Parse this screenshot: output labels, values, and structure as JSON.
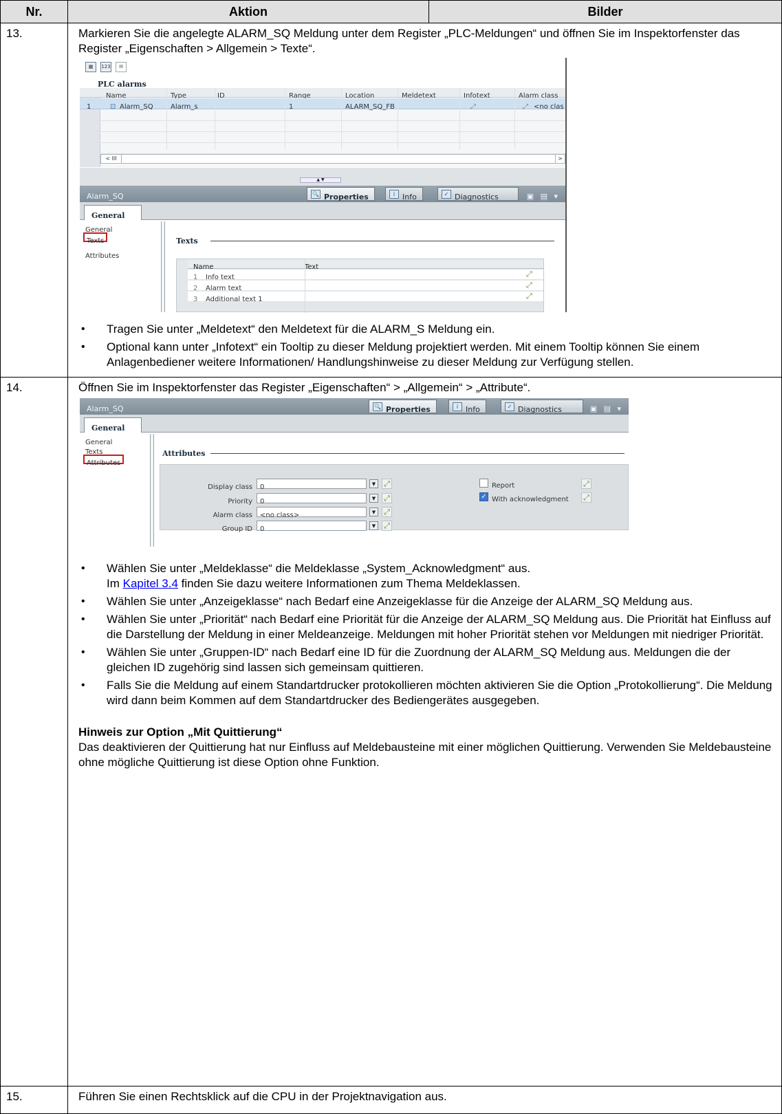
{
  "header": {
    "nr": "Nr.",
    "aktion": "Aktion",
    "bilder": "Bilder"
  },
  "step13": {
    "nr": "13.",
    "intro": "Markieren Sie die angelegte ALARM_SQ Meldung unter dem Register „PLC-Meldungen“ und öffnen Sie im Inspektorfenster das Register „Eigenschaften > Allgemein > Texte“.",
    "screenshot": {
      "panel_title": "PLC alarms",
      "columns": [
        "Name",
        "Type",
        "ID",
        "Range",
        "Location",
        "Meldetext",
        "Infotext",
        "Alarm class"
      ],
      "row": {
        "num": "1",
        "name": "Alarm_SQ",
        "type": "Alarm_s",
        "id": "",
        "range": "1",
        "location": "ALARM_SQ_FB",
        "meldetext": "",
        "infotext_icon": "link-icon",
        "alarm_class": "<no clas"
      },
      "scroll_left": "< III",
      "scroll_right": ">",
      "inspector_title": "Alarm_SQ",
      "tab_properties": "Properties",
      "tab_info": "Info",
      "tab_diagnostics": "Diagnostics",
      "general_tab": "General",
      "nav": [
        "General",
        "Texts",
        "Attributes"
      ],
      "section": "Texts",
      "text_columns": [
        "Name",
        "Text"
      ],
      "text_rows": [
        {
          "num": "1",
          "name": "Info text"
        },
        {
          "num": "2",
          "name": "Alarm text"
        },
        {
          "num": "3",
          "name": "Additional text 1"
        }
      ]
    },
    "bullets": [
      "Tragen Sie unter „Meldetext“ den Meldetext für die ALARM_S Meldung ein.",
      "Optional kann unter „Infotext“ ein Tooltip zu dieser Meldung projektiert werden. Mit einem Tooltip können Sie einem Anlagenbediener weitere Informationen/ Handlungshinweise zu dieser Meldung zur Verfügung stellen."
    ]
  },
  "step14": {
    "nr": "14.",
    "intro": "Öffnen Sie im Inspektorfenster das Register „Eigenschaften“ > „Allgemein“ > „Attribute“.",
    "screenshot": {
      "inspector_title": "Alarm_SQ",
      "tab_properties": "Properties",
      "tab_info": "Info",
      "tab_diagnostics": "Diagnostics",
      "general_tab": "General",
      "nav": [
        "General",
        "Texts",
        "Attributes"
      ],
      "section": "Attributes",
      "fields": [
        {
          "label": "Display class",
          "value": "0"
        },
        {
          "label": "Priority",
          "value": "0"
        },
        {
          "label": "Alarm class",
          "value": "<no class>"
        },
        {
          "label": "Group ID",
          "value": "0"
        }
      ],
      "checkboxes": [
        {
          "label": "Report",
          "checked": false
        },
        {
          "label": "With acknowledgment",
          "checked": true
        }
      ]
    },
    "bullet1_a": "Wählen Sie unter „Meldeklasse“ die Meldeklasse „System_Acknowledgment“ aus.",
    "bullet1_b_pre": "Im ",
    "bullet1_link": "Kapitel 3.4",
    "bullet1_b_post": " finden Sie dazu weitere Informationen zum Thema Meldeklassen.",
    "bullets": [
      "Wählen Sie unter „Anzeigeklasse“ nach Bedarf eine Anzeigeklasse für die Anzeige der ALARM_SQ Meldung aus.",
      "Wählen Sie unter „Priorität“ nach Bedarf eine Priorität für die Anzeige der ALARM_SQ Meldung aus. Die Priorität hat Einfluss auf die Darstellung der Meldung in einer Meldeanzeige. Meldungen mit hoher Priorität stehen vor Meldungen mit niedriger Priorität.",
      "Wählen Sie unter „Gruppen-ID“ nach Bedarf eine ID für die Zuordnung der ALARM_SQ Meldung aus. Meldungen die der gleichen ID zugehörig sind lassen sich gemeinsam quittieren.",
      "Falls Sie die Meldung auf einem Standartdrucker protokollieren möchten aktivieren Sie die Option „Protokollierung“. Die Meldung wird dann beim Kommen auf dem Standartdrucker des Bediengerätes ausgegeben."
    ],
    "note_title": "Hinweis zur Option „Mit Quittierung“",
    "note_text": "Das deaktivieren der Quittierung hat nur Einfluss auf Meldebausteine mit einer möglichen Quittierung. Verwenden Sie Meldebausteine ohne mögliche Quittierung ist diese Option ohne Funktion."
  },
  "step15": {
    "nr": "15.",
    "intro": "Führen Sie einen Rechtsklick auf die CPU in der Projektnavigation aus."
  }
}
